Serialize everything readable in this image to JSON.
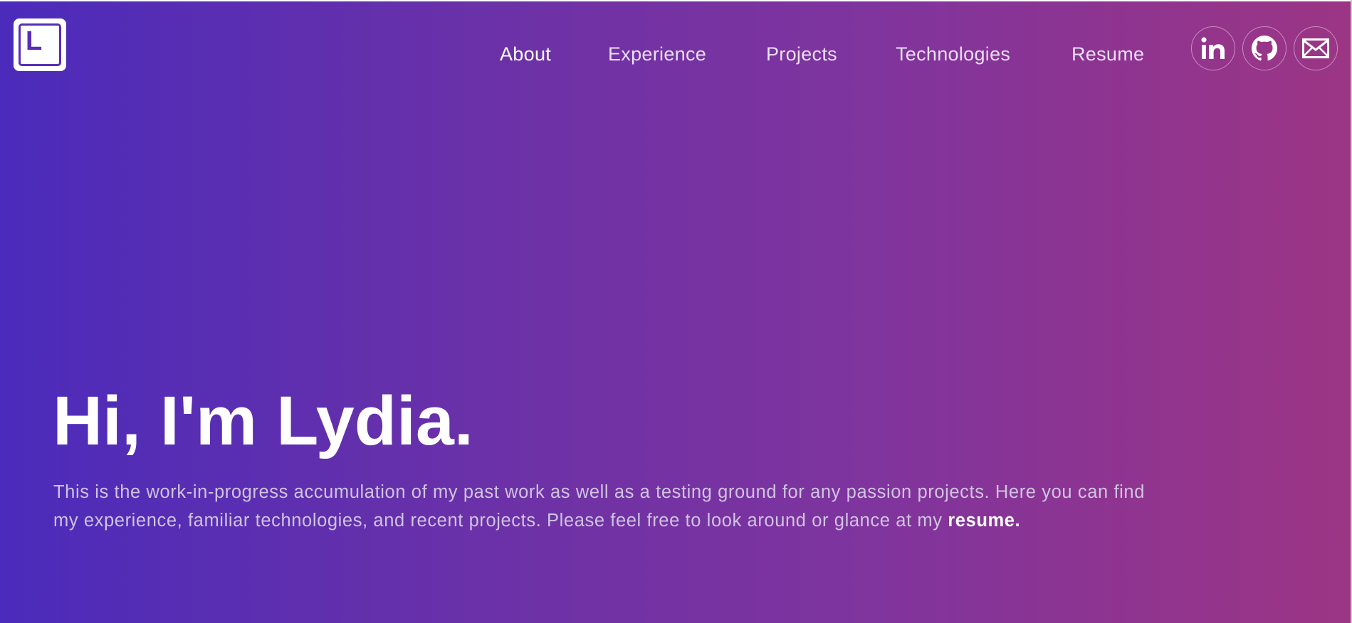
{
  "logo": {
    "letter": "L"
  },
  "nav": {
    "items": [
      {
        "label": "About",
        "active": true
      },
      {
        "label": "Experience",
        "active": false
      },
      {
        "label": "Projects",
        "active": false
      },
      {
        "label": "Technologies",
        "active": false
      },
      {
        "label": "Resume",
        "active": false
      }
    ]
  },
  "social": [
    {
      "icon": "linkedin-icon"
    },
    {
      "icon": "github-icon"
    },
    {
      "icon": "mail-icon"
    }
  ],
  "hero": {
    "title": "Hi, I'm Lydia.",
    "intro_line1": "This is the work-in-progress accumulation of my past work as well as a testing ground for any passion projects. Here you can find",
    "intro_line2": "my experience, familiar technologies, and recent projects. Please feel free to look around or glance at my ",
    "resume_link": "resume."
  },
  "colors": {
    "gradient_start": "#4b2bbb",
    "gradient_end": "#9c3584",
    "text_muted": "#cfc4e0",
    "white": "#ffffff"
  }
}
